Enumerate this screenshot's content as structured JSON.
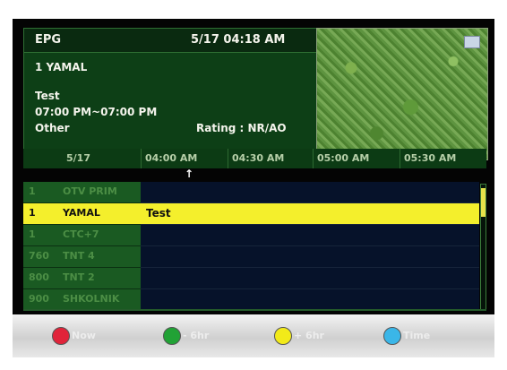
{
  "header": {
    "title": "EPG",
    "datetime": "5/17  04:18 AM"
  },
  "program_info": {
    "channel": "1 YAMAL",
    "title": "Test",
    "time": "07:00 PM~07:00 PM",
    "genre": "Other",
    "rating": "Rating : NR/AO"
  },
  "timebar": {
    "date": "5/17",
    "slots": [
      "04:00 AM",
      "04:30 AM",
      "05:00 AM",
      "05:30 AM"
    ]
  },
  "indicator": "↑",
  "channels": [
    {
      "number": "1",
      "name": "OTV PRIM",
      "program": "",
      "selected": false
    },
    {
      "number": "1",
      "name": "YAMAL",
      "program": "Test",
      "selected": true
    },
    {
      "number": "1",
      "name": "CTC+7",
      "program": "",
      "selected": false
    },
    {
      "number": "760",
      "name": "TNT 4",
      "program": "",
      "selected": false
    },
    {
      "number": "800",
      "name": "TNT 2",
      "program": "",
      "selected": false
    },
    {
      "number": "900",
      "name": "SHKOLNIK",
      "program": "",
      "selected": false
    }
  ],
  "footer_keys": [
    {
      "color": "#e0243a",
      "label": "Now"
    },
    {
      "color": "#21a235",
      "label": "- 6hr"
    },
    {
      "color": "#f2ea19",
      "label": "+ 6hr"
    },
    {
      "color": "#3ab6e8",
      "label": "Time"
    }
  ],
  "colors": {
    "selected_row": "#f4ef2c",
    "channel_bg": "#1a5a22",
    "program_bg": "#06122a"
  }
}
